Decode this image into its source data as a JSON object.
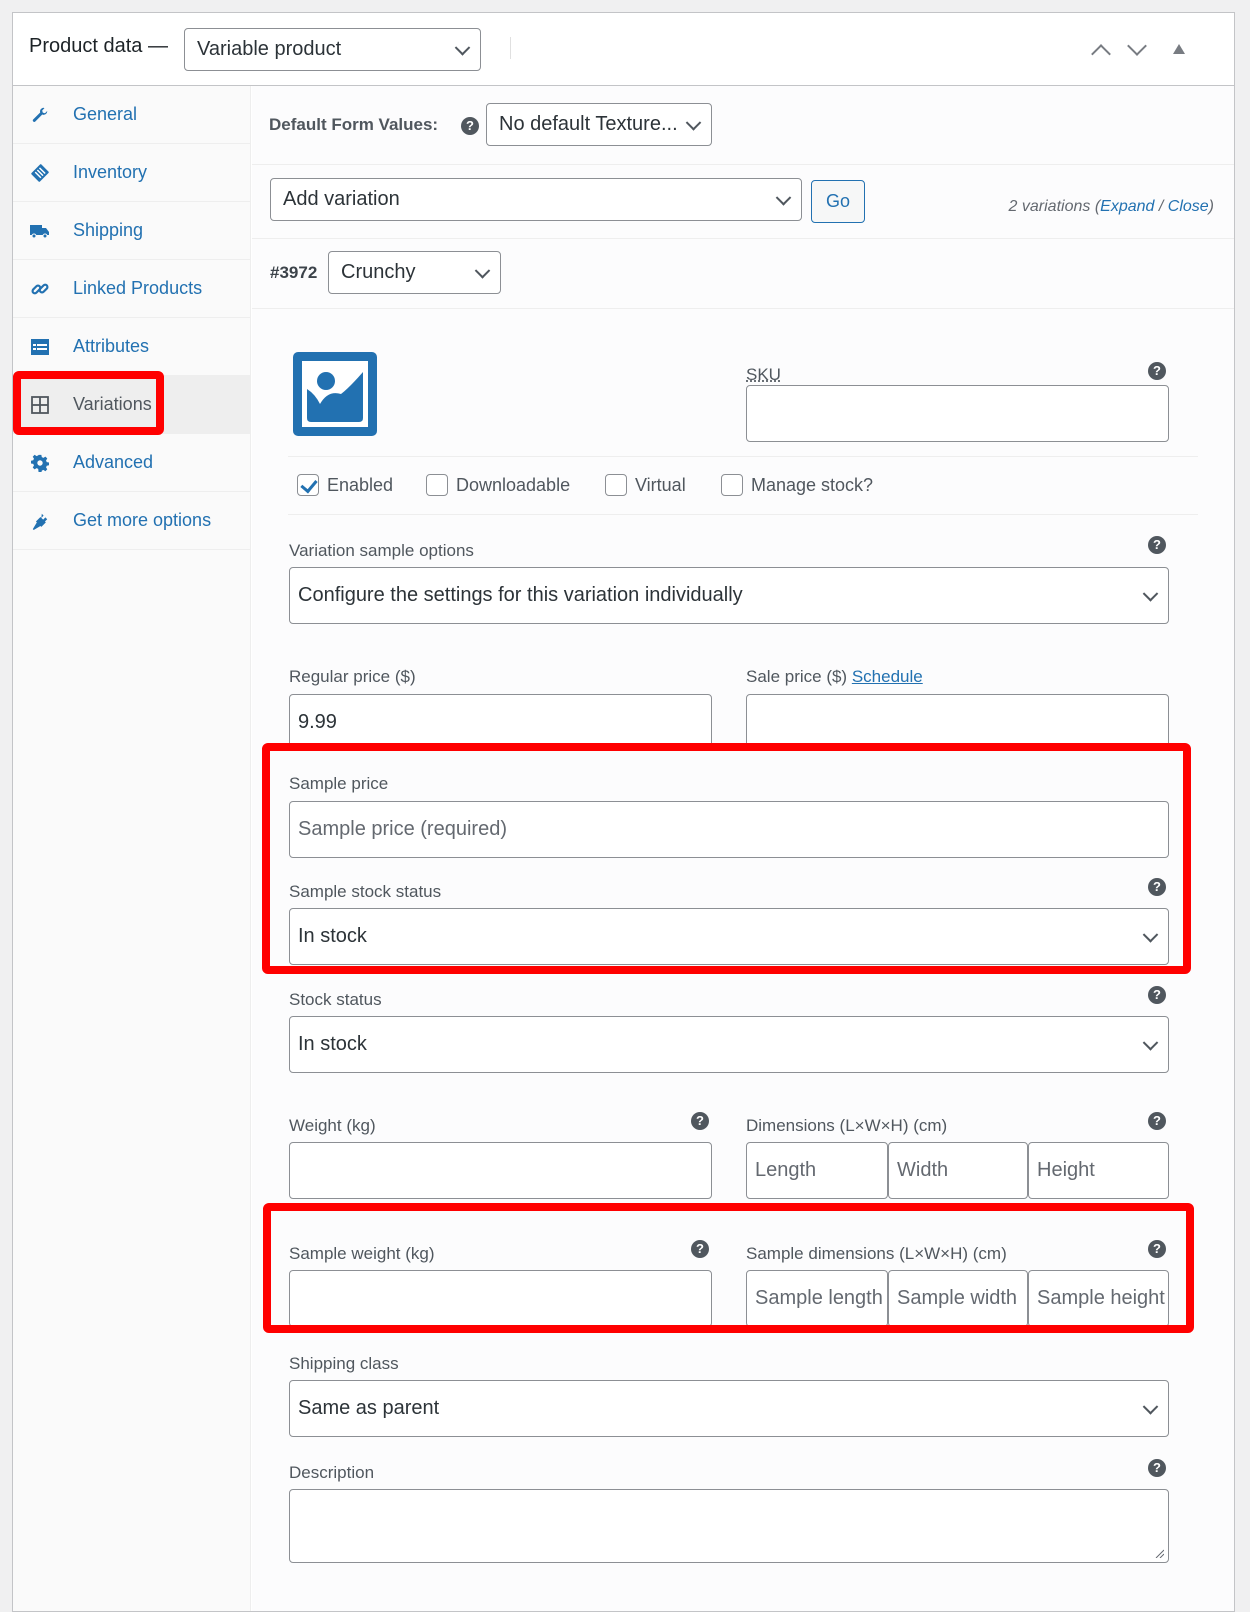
{
  "header": {
    "title": "Product data —",
    "product_type": "Variable product",
    "move_up_icon": "chevron-up-icon",
    "move_down_icon": "chevron-down-icon",
    "toggle_icon": "triangle-up-icon"
  },
  "sidebar": {
    "items": [
      {
        "label": "General",
        "icon": "wrench-icon",
        "active": false
      },
      {
        "label": "Inventory",
        "icon": "clipboard-icon",
        "active": false
      },
      {
        "label": "Shipping",
        "icon": "truck-icon",
        "active": false
      },
      {
        "label": "Linked Products",
        "icon": "link-icon",
        "active": false
      },
      {
        "label": "Attributes",
        "icon": "list-card-icon",
        "active": false
      },
      {
        "label": "Variations",
        "icon": "grid-icon",
        "active": true
      },
      {
        "label": "Advanced",
        "icon": "gear-icon",
        "active": false
      },
      {
        "label": "Get more options",
        "icon": "plug-icon",
        "active": false
      }
    ]
  },
  "toolbar": {
    "default_form_label": "Default Form Values:",
    "default_form_value": "No default Texture...",
    "add_variation_value": "Add variation",
    "go_label": "Go",
    "variations_count": "2 variations",
    "expand_label": "Expand",
    "close_label": "Close"
  },
  "variation": {
    "id": "#3972",
    "attribute_value": "Crunchy",
    "image_icon": "image-placeholder-icon",
    "sku_label": "SKU",
    "sku_value": "",
    "checkboxes": [
      {
        "label": "Enabled",
        "checked": true
      },
      {
        "label": "Downloadable",
        "checked": false
      },
      {
        "label": "Virtual",
        "checked": false
      },
      {
        "label": "Manage stock?",
        "checked": false
      }
    ],
    "sample_options_label": "Variation sample options",
    "sample_options_value": "Configure the settings for this variation individually",
    "regular_price_label": "Regular price ($)",
    "regular_price_value": "9.99",
    "sale_price_label": "Sale price ($)",
    "schedule_label": "Schedule",
    "sale_price_value": "",
    "sample_price_label": "Sample price",
    "sample_price_placeholder": "Sample price (required)",
    "sample_stock_label": "Sample stock status",
    "sample_stock_value": "In stock",
    "stock_status_label": "Stock status",
    "stock_status_value": "In stock",
    "weight_label": "Weight (kg)",
    "dimensions_label": "Dimensions (L×W×H) (cm)",
    "length_placeholder": "Length",
    "width_placeholder": "Width",
    "height_placeholder": "Height",
    "sample_weight_label": "Sample weight (kg)",
    "sample_dimensions_label": "Sample dimensions (L×W×H) (cm)",
    "sample_length_placeholder": "Sample length",
    "sample_width_placeholder": "Sample width",
    "sample_height_placeholder": "Sample height",
    "shipping_class_label": "Shipping class",
    "shipping_class_value": "Same as parent",
    "description_label": "Description",
    "description_value": ""
  },
  "help_glyph": "?",
  "highlight_color": "#ff0000",
  "accent_color": "#2271b1"
}
